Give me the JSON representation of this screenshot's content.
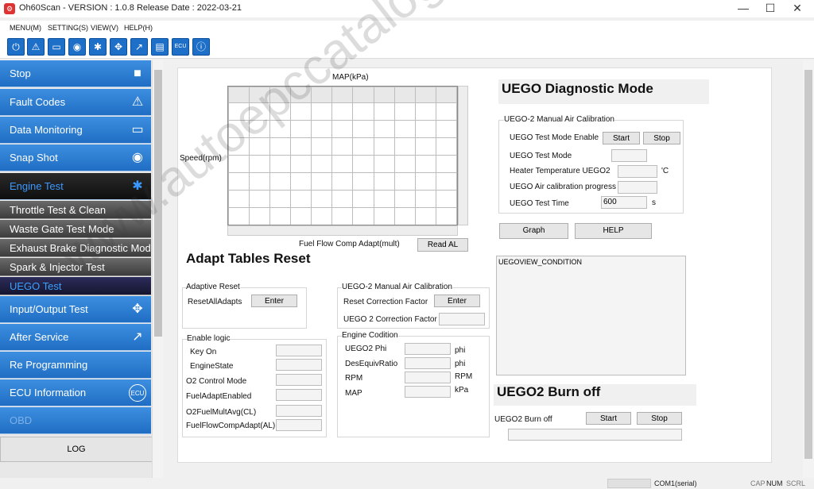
{
  "window": {
    "title": "Oh60Scan - VERSION : 1.0.8 Release Date : 2022-03-21",
    "minimize": "—",
    "maximize": "☐",
    "close": "✕"
  },
  "menu": [
    "MENU(M)",
    "SETTING(S)",
    "VIEW(V)",
    "HELP(H)"
  ],
  "toolbar": {
    "icons": [
      "power-icon",
      "warning-icon",
      "monitor-icon",
      "camera-icon",
      "engine-icon",
      "move-icon",
      "arrow-icon",
      "file-icon",
      "ecu-icon",
      "info-icon"
    ],
    "ecu_text": "ECU"
  },
  "sidebar": {
    "items": [
      {
        "label": "Stop",
        "icon": "stop-icon"
      },
      {
        "label": "Fault Codes",
        "icon": "warning-icon"
      },
      {
        "label": "Data Monitoring",
        "icon": "monitor-icon"
      },
      {
        "label": "Snap Shot",
        "icon": "camera-icon"
      },
      {
        "label": "Engine Test",
        "icon": "engine-icon"
      }
    ],
    "subitems": [
      "Throttle Test & Clean",
      "Waste Gate Test Mode",
      "Exhaust Brake Diagnostic Mode",
      "Spark & Injector Test",
      "UEGO Test"
    ],
    "items2": [
      {
        "label": "Input/Output Test",
        "icon": "move-icon"
      },
      {
        "label": "After Service",
        "icon": "arrow-icon"
      },
      {
        "label": "Re Programming",
        "icon": ""
      },
      {
        "label": "ECU Information",
        "icon": "ecu-icon"
      },
      {
        "label": "OBD",
        "icon": ""
      }
    ],
    "log": "LOG"
  },
  "adapt_table": {
    "x_label": "MAP(kPa)",
    "y_label": "Speed(rpm)",
    "footer_label": "Fuel Flow Comp Adapt(mult)",
    "read_button": "Read AL"
  },
  "adapt_reset": {
    "title": "Adapt Tables Reset",
    "adaptive_reset": {
      "group": "Adaptive Reset",
      "label": "ResetAllAdapts",
      "button": "Enter"
    },
    "manual_cal": {
      "group": "UEGO-2 Manual Air Calibration",
      "reset_label": "Reset Correction Factor",
      "button": "Enter",
      "factor_label": "UEGO 2 Correction Factor"
    },
    "enable_logic": {
      "group": "Enable logic",
      "rows": [
        "Key On",
        "EngineState",
        "O2 Control Mode",
        "FuelAdaptEnabled",
        "O2FuelMultAvg(CL)",
        "FuelFlowCompAdapt(AL)"
      ]
    },
    "engine_condition": {
      "group": "Engine Codition",
      "rows": [
        {
          "label": "UEGO2 Phi",
          "unit": "phi"
        },
        {
          "label": "DesEquivRatio",
          "unit": "phi"
        },
        {
          "label": "RPM",
          "unit": "RPM"
        },
        {
          "label": "MAP",
          "unit": "kPa"
        }
      ]
    }
  },
  "uego": {
    "title": "UEGO Diagnostic Mode",
    "group": "UEGO-2 Manual Air Calibration",
    "test_enable": "UEGO Test Mode Enable",
    "start": "Start",
    "stop": "Stop",
    "test_mode": "UEGO Test Mode",
    "heater": "Heater Temperature UEGO2",
    "heater_unit": "'C",
    "progress": "UEGO Air calibration progress",
    "test_time": "UEGO Test Time",
    "test_time_value": "600",
    "test_time_unit": "s",
    "graph": "Graph",
    "help": "HELP",
    "view_condition": "UEGOVIEW_CONDITION"
  },
  "burnoff": {
    "title": "UEGO2 Burn off",
    "label": "UEGO2 Burn off",
    "start": "Start",
    "stop": "Stop"
  },
  "watermark": "www.autoepccatalog.com",
  "status": {
    "port": "COM1(serial)",
    "cap": "CAP",
    "num": "NUM",
    "scrl": "SCRL"
  }
}
